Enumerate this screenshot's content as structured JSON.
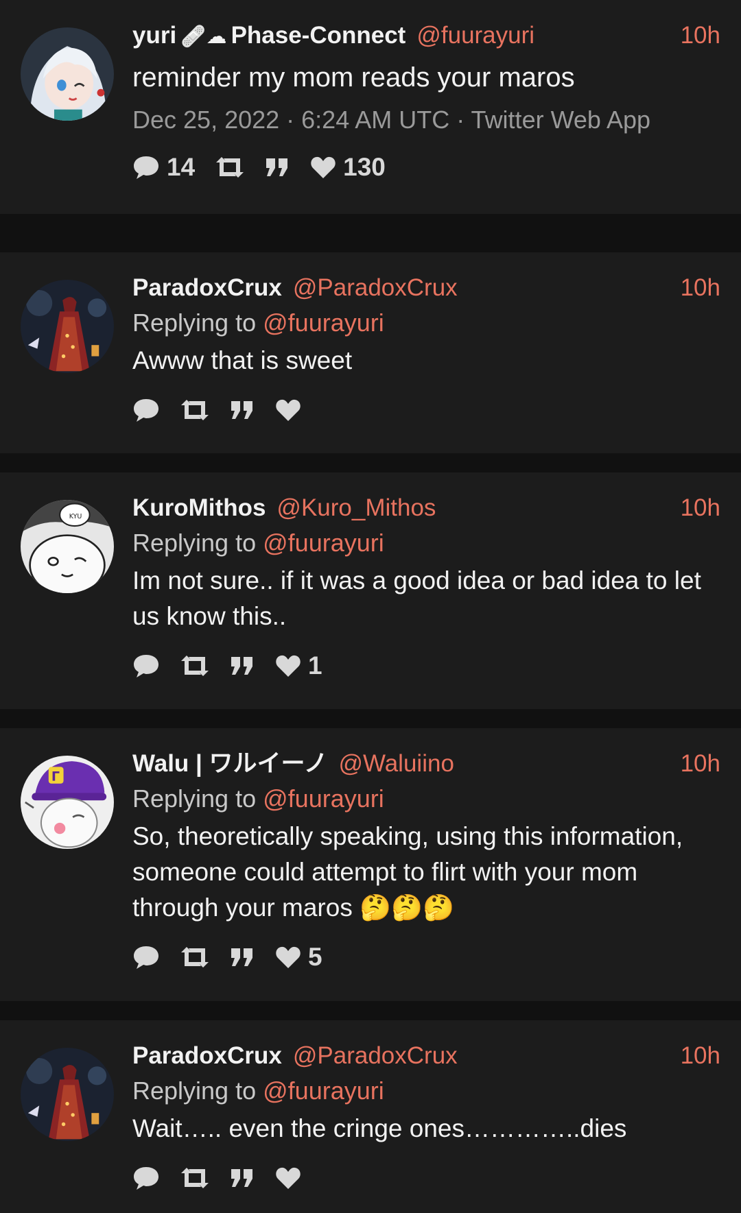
{
  "tweets": [
    {
      "name": "yuri",
      "name_badges": "🩹☁",
      "name_suffix": "Phase-Connect",
      "handle": "@fuurayuri",
      "time": "10h",
      "text": "reminder my mom reads your maros",
      "date": "Dec 25, 2022 · 6:24 AM UTC · Twitter Web App",
      "replies": "14",
      "likes": "130",
      "avatar_icon": "anime-girl-avatar"
    },
    {
      "name": "ParadoxCrux",
      "handle": "@ParadoxCrux",
      "time": "10h",
      "replying_prefix": "Replying to",
      "replying_to": "@fuurayuri",
      "text": "Awww that is sweet",
      "likes": "",
      "avatar_icon": "dark-red-figure-avatar"
    },
    {
      "name": "KuroMithos",
      "handle": "@Kuro_Mithos",
      "time": "10h",
      "replying_prefix": "Replying to",
      "replying_to": "@fuurayuri",
      "text": "Im not sure.. if it was a good idea or bad idea to let us know this..",
      "likes": "1",
      "avatar_icon": "manga-creature-avatar"
    },
    {
      "name": "Walu | ワルイーノ",
      "handle": "@Waluiino",
      "time": "10h",
      "replying_prefix": "Replying to",
      "replying_to": "@fuurayuri",
      "text": "So, theoretically speaking, using this information, someone could attempt to flirt with your mom through your maros 🤔🤔🤔",
      "likes": "5",
      "avatar_icon": "purple-cap-avatar"
    },
    {
      "name": "ParadoxCrux",
      "handle": "@ParadoxCrux",
      "time": "10h",
      "replying_prefix": "Replying to",
      "replying_to": "@fuurayuri",
      "text": "Wait….. even the cringe ones…………..dies",
      "likes": "",
      "avatar_icon": "dark-red-figure-avatar"
    }
  ],
  "colors": {
    "background": "#1c1c1c",
    "separator": "#111111",
    "accent": "#e8735f",
    "text": "#f2f2f2",
    "muted": "#9a9a9a"
  }
}
